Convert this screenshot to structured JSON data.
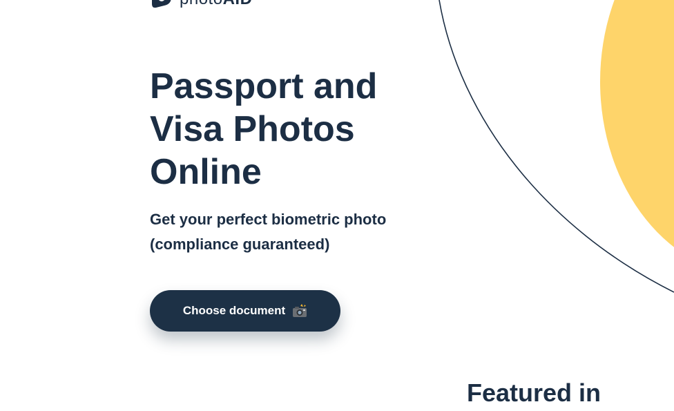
{
  "brand": {
    "logo_text_prefix": "photo",
    "logo_text_suffix": "AID"
  },
  "hero": {
    "title": "Passport and Visa Photos Online",
    "subtitle": "Get your perfect biometric photo (compliance guaranteed)",
    "cta_label": "Choose document",
    "cta_icon": "camera-flash-icon"
  },
  "featured": {
    "title": "Featured in"
  },
  "colors": {
    "text": "#1c2e44",
    "button_bg": "#1d3146",
    "accent_yellow": "#fed46a",
    "background": "#ffffff"
  }
}
